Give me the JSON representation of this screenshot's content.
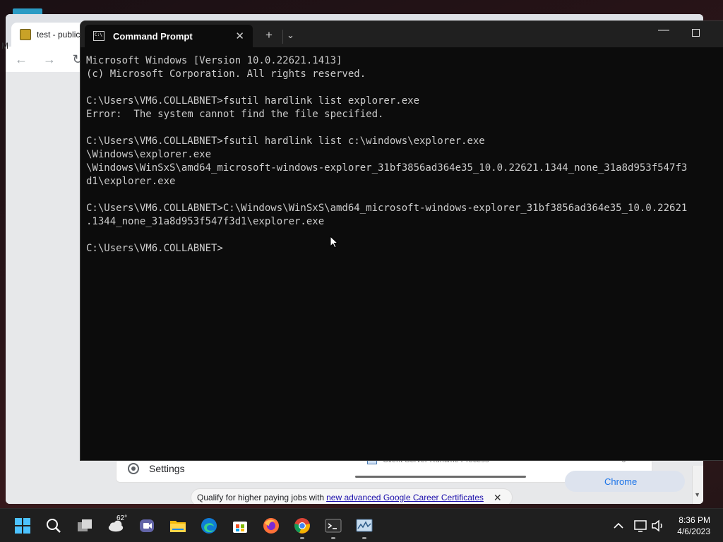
{
  "browser": {
    "tab_title": "test - public",
    "left_letter": "M",
    "settings_label": "Settings",
    "task_item": "Client Server Runtime Process",
    "task_value": "0",
    "pill_text": "Chrome",
    "career_prefix": "Qualify for higher paying jobs with",
    "career_link": "new advanced Google Career Certificates"
  },
  "terminal": {
    "tab_title": "Command Prompt",
    "lines": [
      "Microsoft Windows [Version 10.0.22621.1413]",
      "(c) Microsoft Corporation. All rights reserved.",
      "",
      "C:\\Users\\VM6.COLLABNET>fsutil hardlink list explorer.exe",
      "Error:  The system cannot find the file specified.",
      "",
      "C:\\Users\\VM6.COLLABNET>fsutil hardlink list c:\\windows\\explorer.exe",
      "\\Windows\\explorer.exe",
      "\\Windows\\WinSxS\\amd64_microsoft-windows-explorer_31bf3856ad364e35_10.0.22621.1344_none_31a8d953f547f3",
      "d1\\explorer.exe",
      "",
      "C:\\Users\\VM6.COLLABNET>C:\\Windows\\WinSxS\\amd64_microsoft-windows-explorer_31bf3856ad364e35_10.0.22621",
      ".1344_none_31a8d953f547f3d1\\explorer.exe",
      "",
      "C:\\Users\\VM6.COLLABNET>"
    ]
  },
  "taskbar": {
    "weather_temp": "62°",
    "time": "8:36 PM",
    "date": "4/6/2023",
    "icons": [
      "start-icon",
      "search-icon",
      "task-view-icon",
      "weather-icon",
      "teams-icon",
      "file-explorer-icon",
      "edge-icon",
      "store-icon",
      "firefox-icon",
      "chrome-icon",
      "terminal-icon",
      "monitor-icon"
    ]
  }
}
